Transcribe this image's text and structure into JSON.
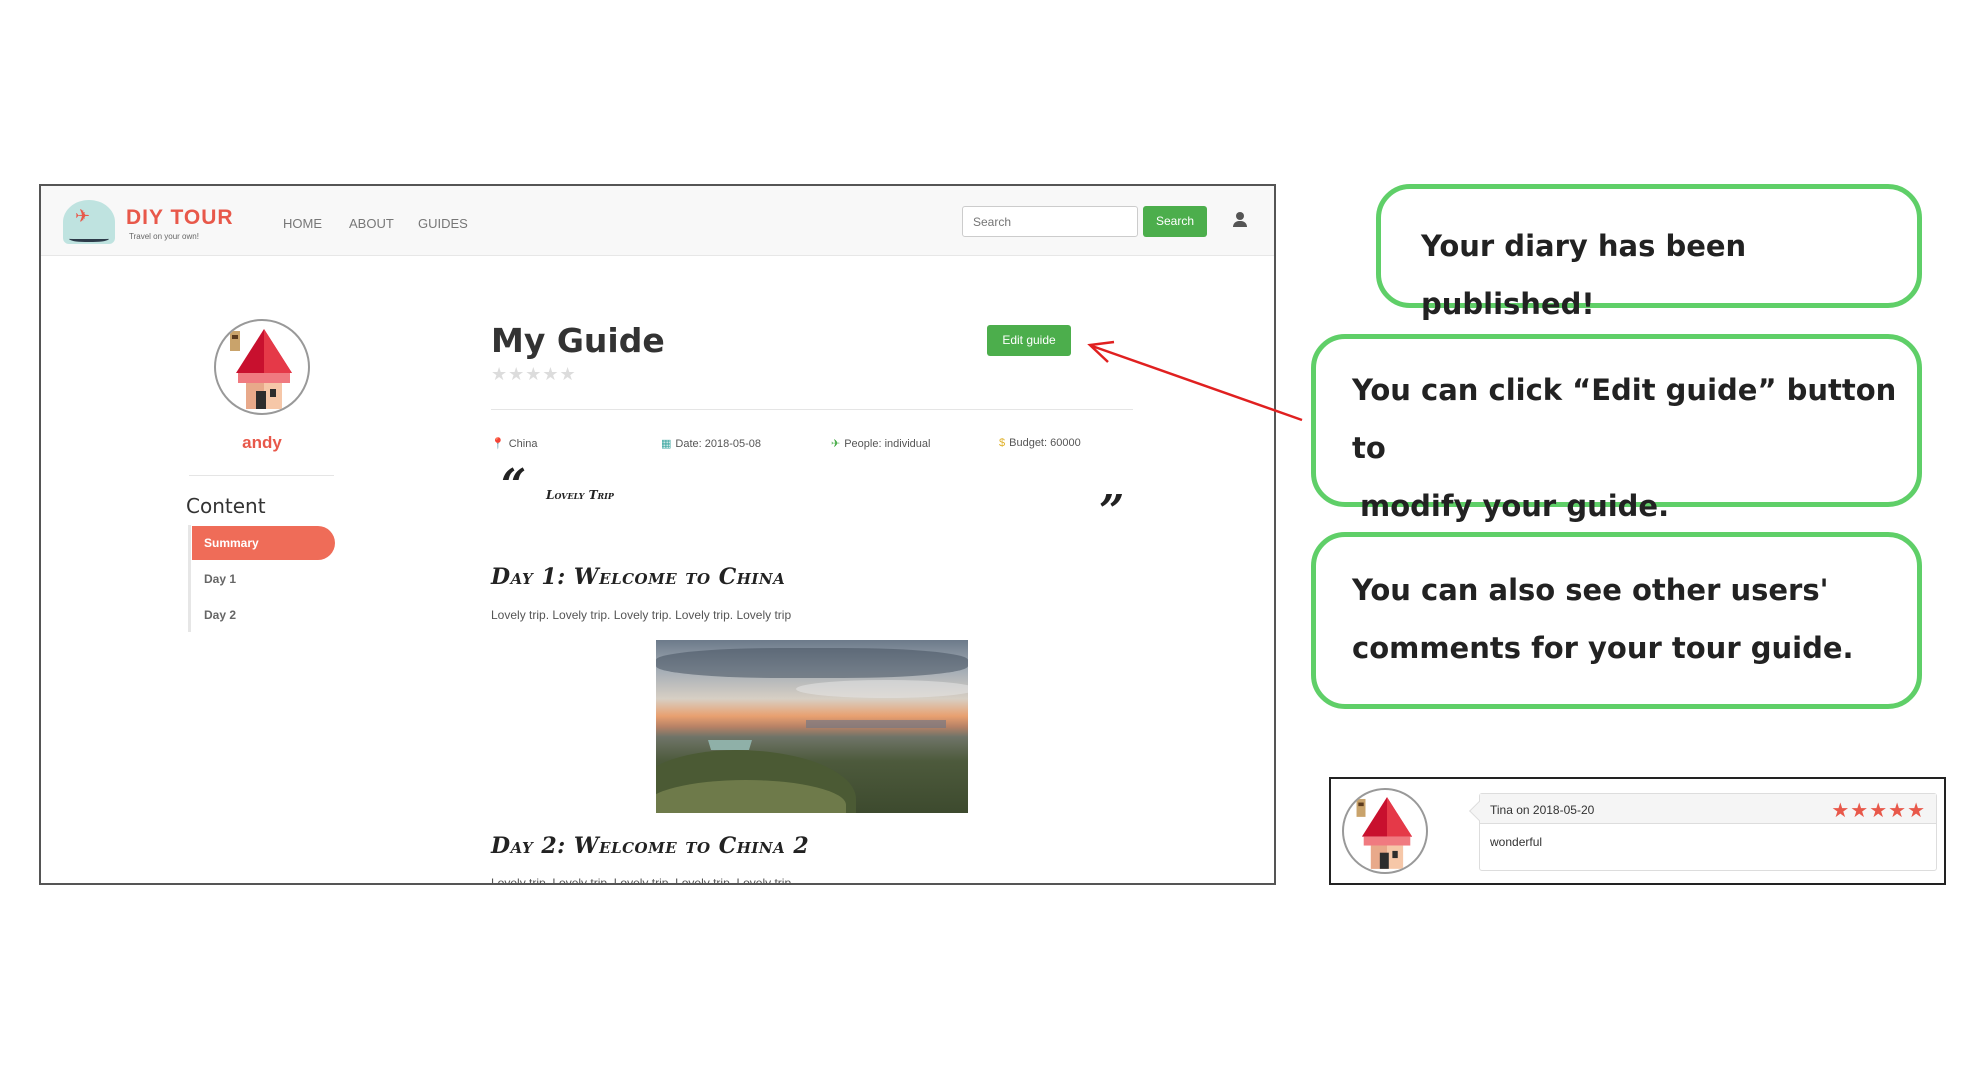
{
  "app": {
    "logo_title": "DIY TOUR",
    "logo_subtitle": "Travel on your own!"
  },
  "nav": {
    "items": [
      {
        "label": "HOME"
      },
      {
        "label": "ABOUT"
      },
      {
        "label": "GUIDES"
      }
    ],
    "search_placeholder": "Search",
    "search_button": "Search",
    "user_icon": "user-icon"
  },
  "profile": {
    "username": "andy",
    "avatar_icon": "pagoda-avatar"
  },
  "sidebar": {
    "title": "Content",
    "items": [
      {
        "label": "Summary",
        "active": true
      },
      {
        "label": "Day 1",
        "active": false
      },
      {
        "label": "Day 2",
        "active": false
      }
    ]
  },
  "guide": {
    "title": "My Guide",
    "rating": 0,
    "rating_max": 5,
    "edit_button": "Edit guide",
    "meta": {
      "location": "China",
      "date": "Date: 2018-05-08",
      "people": "People: individual",
      "budget": "Budget: 60000"
    },
    "quote_open": "“",
    "quote": "Lovely Trip",
    "quote_close": "”",
    "days": [
      {
        "title": "Day 1: Welcome to China",
        "text": "Lovely trip. Lovely trip. Lovely trip. Lovely trip. Lovely trip"
      },
      {
        "title": "Day 2: Welcome to China 2",
        "text": "Lovely trip. Lovely trip. Lovely trip. Lovely trip. Lovely trip"
      }
    ]
  },
  "callouts": [
    {
      "text": "Your diary has been published!"
    },
    {
      "line1": "You can click “Edit guide” button to",
      "line2": "modify your guide."
    },
    {
      "line1": "You can also see other users'",
      "line2": "comments for your tour guide."
    }
  ],
  "comment": {
    "author": "Tina on 2018-05-20",
    "rating": 5,
    "rating_max": 5,
    "body": "wonderful"
  },
  "colors": {
    "brand": "#e8584a",
    "primary_button": "#4cae4c",
    "callout_border": "#5fcf68",
    "arrow": "#e02020",
    "sidebar_active": "#ef6c58"
  }
}
